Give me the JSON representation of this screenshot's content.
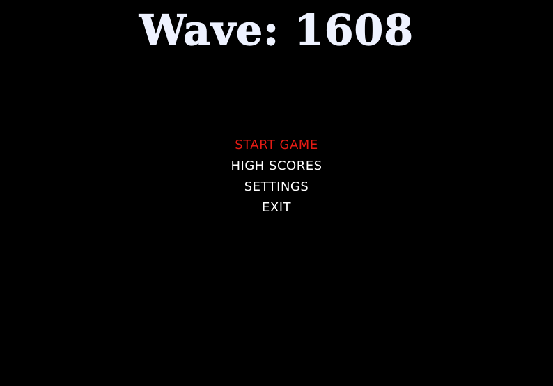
{
  "title": "Wave: 1608",
  "menu": {
    "items": [
      {
        "label": "START GAME",
        "selected": true
      },
      {
        "label": "HIGH SCORES",
        "selected": false
      },
      {
        "label": "SETTINGS",
        "selected": false
      },
      {
        "label": "EXIT",
        "selected": false
      }
    ]
  },
  "colors": {
    "background": "#000000",
    "text": "#ffffff",
    "selected": "#e51b14",
    "title": "#eef2ff"
  }
}
